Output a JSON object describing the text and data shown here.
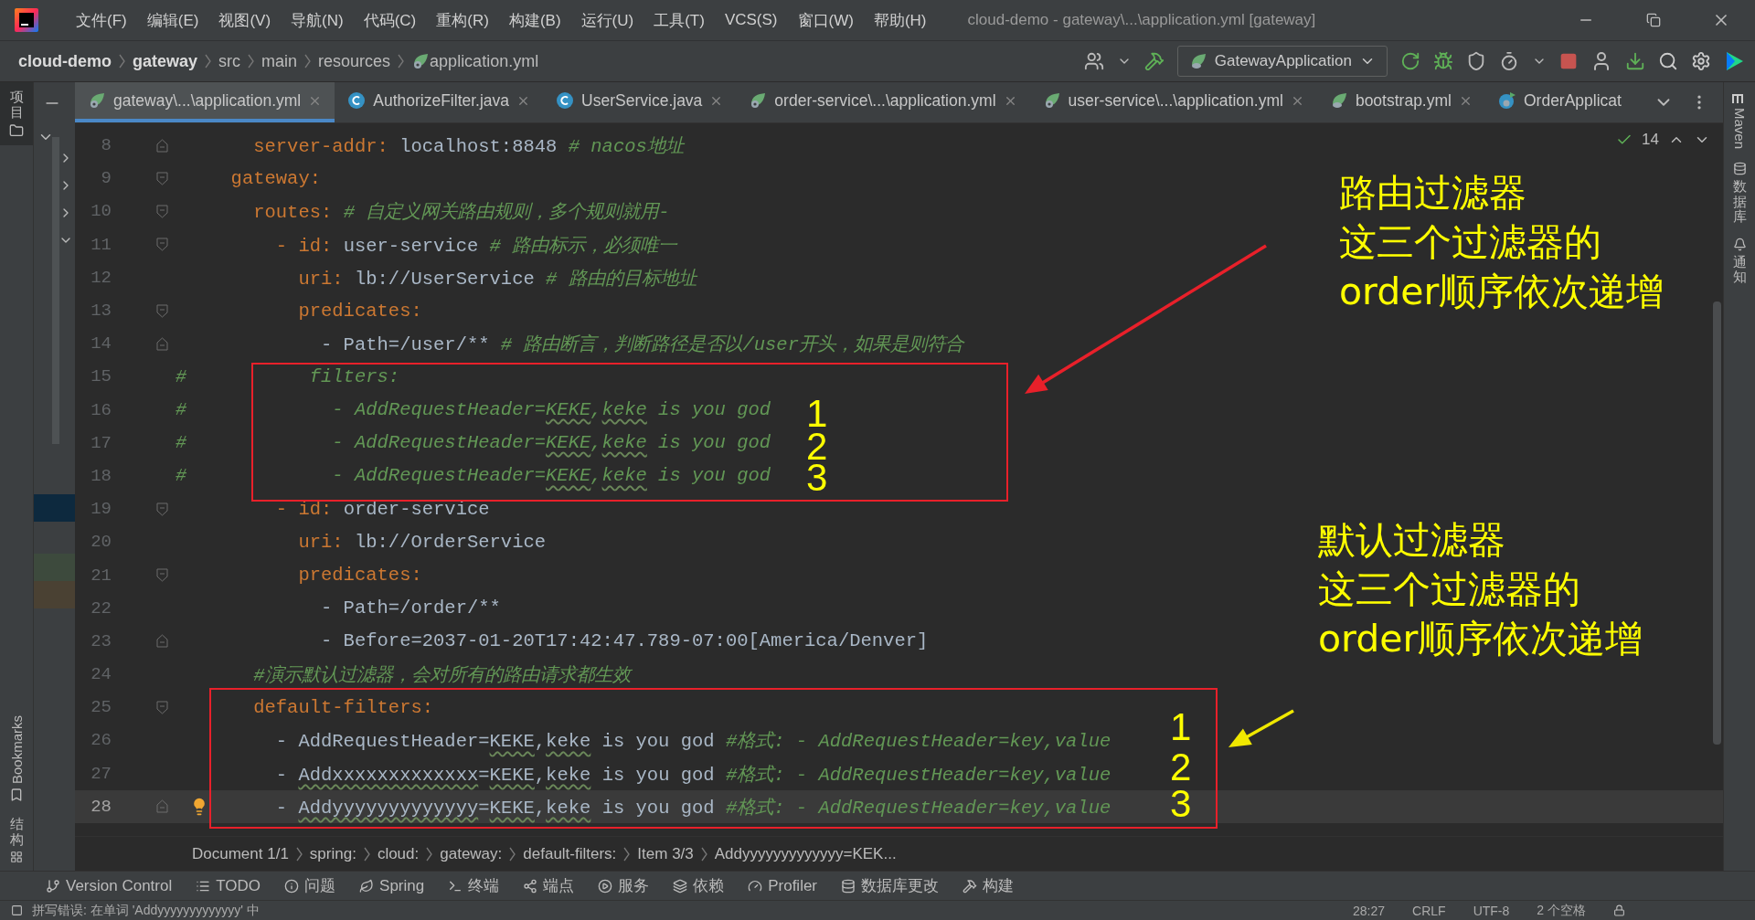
{
  "title_bar": {
    "menu": [
      "文件(F)",
      "编辑(E)",
      "视图(V)",
      "导航(N)",
      "代码(C)",
      "重构(R)",
      "构建(B)",
      "运行(U)",
      "工具(T)",
      "VCS(S)",
      "窗口(W)",
      "帮助(H)"
    ],
    "title": "cloud-demo - gateway\\...\\application.yml [gateway]"
  },
  "nav_bar": {
    "breadcrumbs": [
      {
        "label": "cloud-demo",
        "kind": "module"
      },
      {
        "label": "gateway",
        "kind": "module"
      },
      {
        "label": "src",
        "kind": "folder"
      },
      {
        "label": "main",
        "kind": "folder"
      },
      {
        "label": "resources",
        "kind": "folder"
      },
      {
        "label": "application.yml",
        "kind": "file"
      }
    ],
    "run_config": "GatewayApplication"
  },
  "left_strip": {
    "project": "项目",
    "bookmarks": "Bookmarks",
    "structure": "结构"
  },
  "right_strip": {
    "maven": "Maven",
    "database": "数据库",
    "notifications": "通知"
  },
  "tabs": [
    {
      "label": "gateway\\...\\application.yml",
      "kind": "yml",
      "selected": true
    },
    {
      "label": "AuthorizeFilter.java",
      "kind": "java",
      "selected": false
    },
    {
      "label": "UserService.java",
      "kind": "java",
      "selected": false
    },
    {
      "label": "order-service\\...\\application.yml",
      "kind": "yml",
      "selected": false
    },
    {
      "label": "user-service\\...\\application.yml",
      "kind": "yml",
      "selected": false
    },
    {
      "label": "bootstrap.yml",
      "kind": "bootstrap",
      "selected": false
    },
    {
      "label": "OrderApplicat",
      "kind": "app",
      "selected": false
    }
  ],
  "editor": {
    "inspection_count": "14",
    "lines": [
      {
        "number": "8",
        "kind": "fold_end",
        "current": false,
        "tokens": [
          {
            "kind": "key",
            "text": "    server-addr"
          },
          {
            "kind": "punct",
            "text": ": "
          },
          {
            "kind": "value",
            "text": "localhost:8848 "
          },
          {
            "kind": "comment",
            "text": "# nacos地址"
          }
        ]
      },
      {
        "number": "9",
        "kind": "fold_start",
        "current": false,
        "tokens": [
          {
            "kind": "key",
            "text": "  gateway"
          },
          {
            "kind": "punct",
            "text": ":"
          }
        ]
      },
      {
        "number": "10",
        "kind": "fold_start",
        "current": false,
        "tokens": [
          {
            "kind": "key",
            "text": "    routes"
          },
          {
            "kind": "punct",
            "text": ": "
          },
          {
            "kind": "comment",
            "text": "# 自定义网关路由规则，多个规则就用-"
          }
        ]
      },
      {
        "number": "11",
        "kind": "fold_start",
        "current": false,
        "tokens": [
          {
            "kind": "punct",
            "text": "      - "
          },
          {
            "kind": "key",
            "text": "id"
          },
          {
            "kind": "punct",
            "text": ": "
          },
          {
            "kind": "value",
            "text": "user-service "
          },
          {
            "kind": "comment",
            "text": "# 路由标示，必须唯一"
          }
        ]
      },
      {
        "number": "12",
        "kind": "plain",
        "current": false,
        "tokens": [
          {
            "kind": "key",
            "text": "        uri"
          },
          {
            "kind": "punct",
            "text": ": "
          },
          {
            "kind": "value",
            "text": "lb://UserService "
          },
          {
            "kind": "comment",
            "text": "# 路由的目标地址"
          }
        ]
      },
      {
        "number": "13",
        "kind": "fold_start",
        "current": false,
        "tokens": [
          {
            "kind": "key",
            "text": "        predicates"
          },
          {
            "kind": "punct",
            "text": ":"
          }
        ]
      },
      {
        "number": "14",
        "kind": "fold_end",
        "current": false,
        "tokens": [
          {
            "kind": "value",
            "text": "          - Path=/user/** "
          },
          {
            "kind": "comment",
            "text": "# 路由断言，判断路径是否以/user开头，如果是则符合"
          }
        ]
      },
      {
        "number": "15",
        "kind": "plain",
        "hash": "#",
        "current": false,
        "tokens": [
          {
            "kind": "comment",
            "text": "         filters:"
          }
        ]
      },
      {
        "number": "16",
        "kind": "plain",
        "hash": "#",
        "current": false,
        "tokens": [
          {
            "kind": "comment",
            "text": "           - AddRequestHeader="
          },
          {
            "kind": "comment_typo",
            "text": "KEKE"
          },
          {
            "kind": "comment",
            "text": ","
          },
          {
            "kind": "comment_typo",
            "text": "keke"
          },
          {
            "kind": "comment",
            "text": " is you god"
          }
        ]
      },
      {
        "number": "17",
        "kind": "plain",
        "hash": "#",
        "current": false,
        "tokens": [
          {
            "kind": "comment",
            "text": "           - AddRequestHeader="
          },
          {
            "kind": "comment_typo",
            "text": "KEKE"
          },
          {
            "kind": "comment",
            "text": ","
          },
          {
            "kind": "comment_typo",
            "text": "keke"
          },
          {
            "kind": "comment",
            "text": " is you god"
          }
        ]
      },
      {
        "number": "18",
        "kind": "plain",
        "hash": "#",
        "current": false,
        "tokens": [
          {
            "kind": "comment",
            "text": "           - AddRequestHeader="
          },
          {
            "kind": "comment_typo",
            "text": "KEKE"
          },
          {
            "kind": "comment",
            "text": ","
          },
          {
            "kind": "comment_typo",
            "text": "keke"
          },
          {
            "kind": "comment",
            "text": " is you god"
          }
        ]
      },
      {
        "number": "19",
        "kind": "fold_start",
        "current": false,
        "tokens": [
          {
            "kind": "punct",
            "text": "      - "
          },
          {
            "kind": "key",
            "text": "id"
          },
          {
            "kind": "punct",
            "text": ": "
          },
          {
            "kind": "value",
            "text": "order-service"
          }
        ]
      },
      {
        "number": "20",
        "kind": "plain",
        "current": false,
        "tokens": [
          {
            "kind": "key",
            "text": "        uri"
          },
          {
            "kind": "punct",
            "text": ": "
          },
          {
            "kind": "value",
            "text": "lb://OrderService"
          }
        ]
      },
      {
        "number": "21",
        "kind": "fold_start",
        "current": false,
        "tokens": [
          {
            "kind": "key",
            "text": "        predicates"
          },
          {
            "kind": "punct",
            "text": ":"
          }
        ]
      },
      {
        "number": "22",
        "kind": "plain",
        "current": false,
        "tokens": [
          {
            "kind": "value",
            "text": "          - Path=/order/**"
          }
        ]
      },
      {
        "number": "23",
        "kind": "fold_end",
        "current": false,
        "tokens": [
          {
            "kind": "value",
            "text": "          - Before=2037-01-20T17:42:47.789-07:00[America/Denver]"
          }
        ]
      },
      {
        "number": "24",
        "kind": "plain",
        "current": false,
        "tokens": [
          {
            "kind": "comment",
            "text": "    #演示默认过滤器，会对所有的路由请求都生效"
          }
        ]
      },
      {
        "number": "25",
        "kind": "fold_start",
        "current": false,
        "tokens": [
          {
            "kind": "key",
            "text": "    default-filters"
          },
          {
            "kind": "punct",
            "text": ":"
          }
        ]
      },
      {
        "number": "26",
        "kind": "plain",
        "current": false,
        "tokens": [
          {
            "kind": "value",
            "text": "      - AddRequestHeader="
          },
          {
            "kind": "typo",
            "text": "KEKE"
          },
          {
            "kind": "value",
            "text": ","
          },
          {
            "kind": "typo",
            "text": "keke"
          },
          {
            "kind": "value",
            "text": " is you god "
          },
          {
            "kind": "comment",
            "text": "#格式: - AddRequestHeader=key,value"
          }
        ]
      },
      {
        "number": "27",
        "kind": "plain",
        "current": false,
        "tokens": [
          {
            "kind": "value",
            "text": "      - "
          },
          {
            "kind": "typo",
            "text": "Addxxxxxxxxxxxxx"
          },
          {
            "kind": "value",
            "text": "="
          },
          {
            "kind": "typo",
            "text": "KEKE"
          },
          {
            "kind": "value",
            "text": ","
          },
          {
            "kind": "typo",
            "text": "keke"
          },
          {
            "kind": "value",
            "text": " is you god "
          },
          {
            "kind": "comment",
            "text": "#格式: - AddRequestHeader=key,value"
          }
        ]
      },
      {
        "number": "28",
        "kind": "fold_end",
        "current": true,
        "tokens": [
          {
            "kind": "value",
            "text": "      - "
          },
          {
            "kind": "typo",
            "text": "Addyyyyyyyyyyyyy"
          },
          {
            "kind": "value",
            "text": "="
          },
          {
            "kind": "typo",
            "text": "KEKE"
          },
          {
            "kind": "value",
            "text": ","
          },
          {
            "kind": "typo",
            "text": "keke"
          },
          {
            "kind": "value",
            "text": " is you god "
          },
          {
            "kind": "comment",
            "text": "#格式: - AddRequestHeader=key,value"
          }
        ]
      }
    ]
  },
  "annotations": {
    "boxes": [
      {
        "numbers": [
          "1",
          "2",
          "3"
        ]
      },
      {
        "numbers": [
          "1",
          "2",
          "3"
        ]
      }
    ],
    "notes": [
      {
        "lines": [
          "路由过滤器",
          "这三个过滤器的",
          "order顺序依次递增"
        ]
      },
      {
        "lines": [
          "默认过滤器",
          "这三个过滤器的",
          "order顺序依次递增"
        ]
      }
    ]
  },
  "breadcrumb": [
    "Document 1/1",
    "spring:",
    "cloud:",
    "gateway:",
    "default-filters:",
    "Item 3/3",
    "Addyyyyyyyyyyyyy=KEK..."
  ],
  "tool_windows": [
    "Version Control",
    "TODO",
    "问题",
    "Spring",
    "终端",
    "端点",
    "服务",
    "依赖",
    "Profiler",
    "数据库更改",
    "构建"
  ],
  "status_bar": {
    "message": "拼写错误: 在单词 'Addyyyyyyyyyyyyy' 中",
    "position": "28:27",
    "line_separator": "CRLF",
    "encoding": "UTF-8",
    "indent": "2 个空格"
  }
}
